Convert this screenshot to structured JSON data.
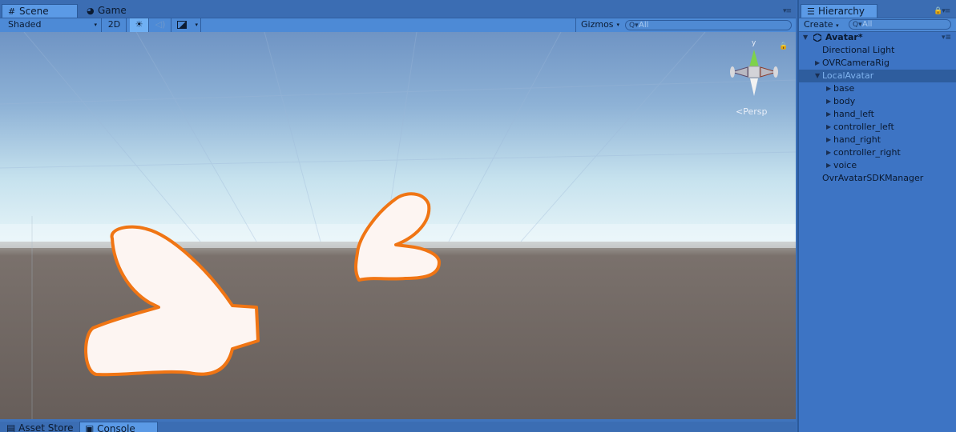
{
  "scene": {
    "tabs": [
      {
        "label": "Scene",
        "icon": "grid-icon",
        "active": true
      },
      {
        "label": "Game",
        "icon": "pacman-icon",
        "active": false
      }
    ],
    "toolbar": {
      "shading": "Shaded",
      "mode_2d": "2D",
      "gizmos": "Gizmos",
      "search_placeholder": "All"
    },
    "gizmo_label": "Persp",
    "gizmo_axis_y": "y",
    "bottom_tabs": [
      {
        "label": "Asset Store",
        "icon": "store-icon",
        "active": false
      },
      {
        "label": "Console",
        "icon": "console-icon",
        "active": true
      }
    ],
    "colors": {
      "sky_top": "#6f94c4",
      "horizon": "#e6f4f8",
      "ground": "#6b625e",
      "selection_outline": "#f07514",
      "hand_fill": "#fdf5f2"
    }
  },
  "hierarchy": {
    "tab_label": "Hierarchy",
    "create_label": "Create",
    "search_placeholder": "All",
    "root": "Avatar*",
    "items": [
      {
        "label": "Directional Light",
        "depth": 1,
        "expandable": false,
        "selected": false
      },
      {
        "label": "OVRCameraRig",
        "depth": 1,
        "expandable": true,
        "selected": false
      },
      {
        "label": "LocalAvatar",
        "depth": 1,
        "expandable": true,
        "expanded": true,
        "selected": true
      },
      {
        "label": "base",
        "depth": 2,
        "expandable": true,
        "selected": false
      },
      {
        "label": "body",
        "depth": 2,
        "expandable": true,
        "selected": false
      },
      {
        "label": "hand_left",
        "depth": 2,
        "expandable": true,
        "selected": false
      },
      {
        "label": "controller_left",
        "depth": 2,
        "expandable": true,
        "selected": false
      },
      {
        "label": "hand_right",
        "depth": 2,
        "expandable": true,
        "selected": false
      },
      {
        "label": "controller_right",
        "depth": 2,
        "expandable": true,
        "selected": false
      },
      {
        "label": "voice",
        "depth": 2,
        "expandable": true,
        "selected": false
      },
      {
        "label": "OvrAvatarSDKManager",
        "depth": 1,
        "expandable": false,
        "selected": false
      }
    ]
  }
}
